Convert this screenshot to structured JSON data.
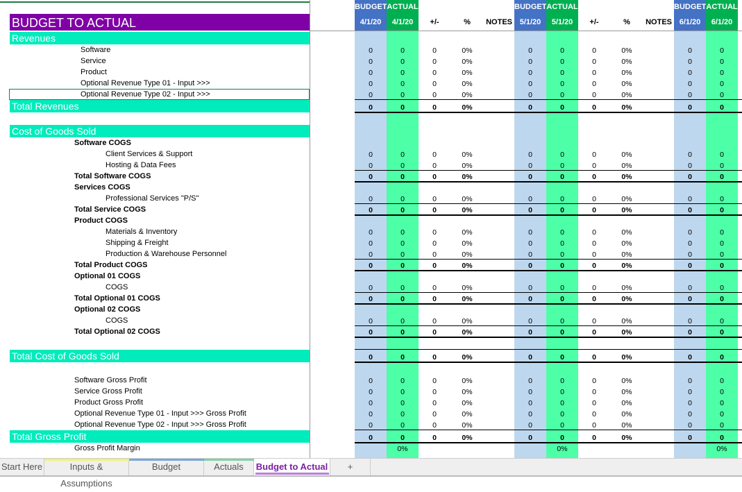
{
  "title": "BUDGET TO ACTUAL",
  "colors": {
    "title_bg": "#7f00a5",
    "section_bg": "#00ecbc",
    "budget_bg": "#bdd7ee",
    "actual_bg": "#4dffa6",
    "budget_hdr": "#4472c4",
    "actual_hdr": "#00b050",
    "selection": "#1e7b45"
  },
  "periods": [
    {
      "budget_label": "BUDGET",
      "actual_label": "ACTUAL",
      "budget_date": "4/1/20",
      "actual_date": "4/1/20",
      "diff_label": "+/-",
      "pct_label": "%",
      "notes_label": "NOTES"
    },
    {
      "budget_label": "BUDGET",
      "actual_label": "ACTUAL",
      "budget_date": "5/1/20",
      "actual_date": "5/1/20",
      "diff_label": "+/-",
      "pct_label": "%",
      "notes_label": "NOTES"
    },
    {
      "budget_label": "BUDGET",
      "actual_label": "ACTUAL",
      "budget_date": "6/1/20",
      "actual_date": "6/1/20"
    }
  ],
  "rows": [
    {
      "type": "section",
      "label": "Revenues"
    },
    {
      "type": "item",
      "indent": 1,
      "label": "Software",
      "cells": [
        [
          "0",
          "0",
          "0",
          "0%"
        ],
        [
          "0",
          "0",
          "0",
          "0%"
        ],
        [
          "0",
          "0"
        ]
      ]
    },
    {
      "type": "item",
      "indent": 1,
      "label": "Service",
      "cells": [
        [
          "0",
          "0",
          "0",
          "0%"
        ],
        [
          "0",
          "0",
          "0",
          "0%"
        ],
        [
          "0",
          "0"
        ]
      ]
    },
    {
      "type": "item",
      "indent": 1,
      "label": "Product",
      "cells": [
        [
          "0",
          "0",
          "0",
          "0%"
        ],
        [
          "0",
          "0",
          "0",
          "0%"
        ],
        [
          "0",
          "0"
        ]
      ]
    },
    {
      "type": "item",
      "indent": 1,
      "label": "Optional Revenue Type 01 - Input >>>",
      "cells": [
        [
          "0",
          "0",
          "0",
          "0%"
        ],
        [
          "0",
          "0",
          "0",
          "0%"
        ],
        [
          "0",
          "0"
        ]
      ]
    },
    {
      "type": "item",
      "indent": 1,
      "label": "Optional Revenue Type 02 - Input >>>",
      "selected": true,
      "cells": [
        [
          "0",
          "0",
          "0",
          "0%"
        ],
        [
          "0",
          "0",
          "0",
          "0%"
        ],
        [
          "0",
          "0"
        ]
      ]
    },
    {
      "type": "sectotal",
      "label": "Total Revenues",
      "cells": [
        [
          "0",
          "0",
          "0",
          "0%"
        ],
        [
          "0",
          "0",
          "0",
          "0%"
        ],
        [
          "0",
          "0"
        ]
      ]
    },
    {
      "type": "blank"
    },
    {
      "type": "section",
      "label": "Cost of Goods Sold"
    },
    {
      "type": "head",
      "label": "Software COGS"
    },
    {
      "type": "item",
      "indent": 2,
      "label": "Client Services & Support",
      "cells": [
        [
          "0",
          "0",
          "0",
          "0%"
        ],
        [
          "0",
          "0",
          "0",
          "0%"
        ],
        [
          "0",
          "0"
        ]
      ]
    },
    {
      "type": "item",
      "indent": 2,
      "label": "Hosting & Data Fees",
      "cells": [
        [
          "0",
          "0",
          "0",
          "0%"
        ],
        [
          "0",
          "0",
          "0",
          "0%"
        ],
        [
          "0",
          "0"
        ]
      ]
    },
    {
      "type": "total",
      "label": "Total Software COGS",
      "cells": [
        [
          "0",
          "0",
          "0",
          "0%"
        ],
        [
          "0",
          "0",
          "0",
          "0%"
        ],
        [
          "0",
          "0"
        ]
      ]
    },
    {
      "type": "head",
      "label": "Services COGS"
    },
    {
      "type": "item",
      "indent": 2,
      "label": "Professional Services \"P/S\"",
      "cells": [
        [
          "0",
          "0",
          "0",
          "0%"
        ],
        [
          "0",
          "0",
          "0",
          "0%"
        ],
        [
          "0",
          "0"
        ]
      ]
    },
    {
      "type": "total",
      "label": "Total Service COGS",
      "cells": [
        [
          "0",
          "0",
          "0",
          "0%"
        ],
        [
          "0",
          "0",
          "0",
          "0%"
        ],
        [
          "0",
          "0"
        ]
      ]
    },
    {
      "type": "head",
      "label": "Product COGS"
    },
    {
      "type": "item",
      "indent": 2,
      "label": "Materials & Inventory",
      "cells": [
        [
          "0",
          "0",
          "0",
          "0%"
        ],
        [
          "0",
          "0",
          "0",
          "0%"
        ],
        [
          "0",
          "0"
        ]
      ]
    },
    {
      "type": "item",
      "indent": 2,
      "label": "Shipping & Freight",
      "cells": [
        [
          "0",
          "0",
          "0",
          "0%"
        ],
        [
          "0",
          "0",
          "0",
          "0%"
        ],
        [
          "0",
          "0"
        ]
      ]
    },
    {
      "type": "item",
      "indent": 2,
      "label": "Production & Warehouse Personnel",
      "cells": [
        [
          "0",
          "0",
          "0",
          "0%"
        ],
        [
          "0",
          "0",
          "0",
          "0%"
        ],
        [
          "0",
          "0"
        ]
      ]
    },
    {
      "type": "total",
      "label": "Total Product COGS",
      "cells": [
        [
          "0",
          "0",
          "0",
          "0%"
        ],
        [
          "0",
          "0",
          "0",
          "0%"
        ],
        [
          "0",
          "0"
        ]
      ]
    },
    {
      "type": "head",
      "label": "Optional 01 COGS"
    },
    {
      "type": "item",
      "indent": 2,
      "label": "COGS",
      "cells": [
        [
          "0",
          "0",
          "0",
          "0%"
        ],
        [
          "0",
          "0",
          "0",
          "0%"
        ],
        [
          "0",
          "0"
        ]
      ]
    },
    {
      "type": "total",
      "label": "Total Optional 01 COGS",
      "cells": [
        [
          "0",
          "0",
          "0",
          "0%"
        ],
        [
          "0",
          "0",
          "0",
          "0%"
        ],
        [
          "0",
          "0"
        ]
      ]
    },
    {
      "type": "head",
      "label": "Optional 02 COGS"
    },
    {
      "type": "item",
      "indent": 2,
      "label": "COGS",
      "cells": [
        [
          "0",
          "0",
          "0",
          "0%"
        ],
        [
          "0",
          "0",
          "0",
          "0%"
        ],
        [
          "0",
          "0"
        ]
      ]
    },
    {
      "type": "total",
      "label": "Total Optional 02 COGS",
      "cells": [
        [
          "0",
          "0",
          "0",
          "0%"
        ],
        [
          "0",
          "0",
          "0",
          "0%"
        ],
        [
          "0",
          "0"
        ]
      ]
    },
    {
      "type": "blank"
    },
    {
      "type": "sectotal",
      "label": "Total Cost of Goods Sold",
      "cells": [
        [
          "0",
          "0",
          "0",
          "0%"
        ],
        [
          "0",
          "0",
          "0",
          "0%"
        ],
        [
          "0",
          "0"
        ]
      ]
    },
    {
      "type": "blank"
    },
    {
      "type": "item",
      "indent": 0,
      "label": "Software Gross Profit",
      "cells": [
        [
          "0",
          "0",
          "0",
          "0%"
        ],
        [
          "0",
          "0",
          "0",
          "0%"
        ],
        [
          "0",
          "0"
        ]
      ]
    },
    {
      "type": "item",
      "indent": 0,
      "label": "Service Gross Profit",
      "cells": [
        [
          "0",
          "0",
          "0",
          "0%"
        ],
        [
          "0",
          "0",
          "0",
          "0%"
        ],
        [
          "0",
          "0"
        ]
      ]
    },
    {
      "type": "item",
      "indent": 0,
      "label": "Product Gross Profit",
      "cells": [
        [
          "0",
          "0",
          "0",
          "0%"
        ],
        [
          "0",
          "0",
          "0",
          "0%"
        ],
        [
          "0",
          "0"
        ]
      ]
    },
    {
      "type": "item",
      "indent": 0,
      "label": "Optional Revenue Type 01 - Input >>> Gross Profit",
      "cells": [
        [
          "0",
          "0",
          "0",
          "0%"
        ],
        [
          "0",
          "0",
          "0",
          "0%"
        ],
        [
          "0",
          "0"
        ]
      ]
    },
    {
      "type": "item",
      "indent": 0,
      "label": "Optional Revenue Type 02 - Input >>> Gross Profit",
      "cells": [
        [
          "0",
          "0",
          "0",
          "0%"
        ],
        [
          "0",
          "0",
          "0",
          "0%"
        ],
        [
          "0",
          "0"
        ]
      ]
    },
    {
      "type": "sectotal",
      "label": "Total Gross Profit",
      "cells": [
        [
          "0",
          "0",
          "0",
          "0%"
        ],
        [
          "0",
          "0",
          "0",
          "0%"
        ],
        [
          "0",
          "0"
        ]
      ]
    },
    {
      "type": "item",
      "indent": 0,
      "label": "Gross Profit Margin",
      "cells": [
        [
          "",
          "0%",
          "",
          ""
        ],
        [
          "",
          "0%",
          "",
          ""
        ],
        [
          "",
          "0%"
        ]
      ]
    }
  ],
  "tabs": [
    {
      "label": "Start Here",
      "accent": ""
    },
    {
      "label": "Inputs & Assumptions",
      "accent": "#f4f07a"
    },
    {
      "label": "Budget",
      "accent": "#7ba7d9"
    },
    {
      "label": "Actuals",
      "accent": "#7fd3a6"
    },
    {
      "label": "Budget to Actual",
      "accent": "#b87fd9",
      "active": true
    },
    {
      "label": "+",
      "accent": ""
    }
  ]
}
